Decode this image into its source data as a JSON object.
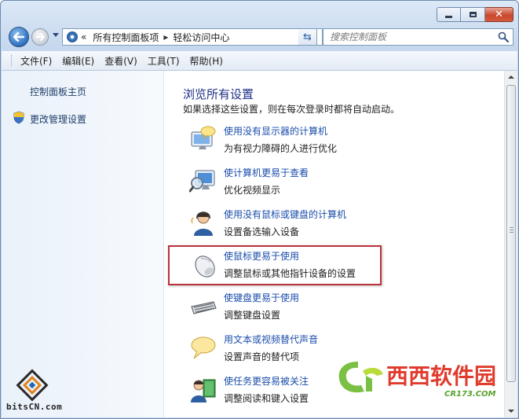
{
  "window": {
    "caption_buttons": [
      "minimize",
      "maximize",
      "close"
    ]
  },
  "nav": {
    "address_prefix": "«",
    "breadcrumbs": [
      "所有控制面板项",
      "轻松访问中心"
    ],
    "breadcrumb_separator": "▸",
    "search_placeholder": "搜索控制面板"
  },
  "menubar": {
    "items": [
      "文件(F)",
      "编辑(E)",
      "查看(V)",
      "工具(T)",
      "帮助(H)"
    ]
  },
  "sidebar": {
    "home_link": "控制面板主页",
    "admin_link": "更改管理设置"
  },
  "main": {
    "title": "浏览所有设置",
    "subtitle": "如果选择这些设置，则在每次登录时都将自动启动。",
    "items": [
      {
        "icon": "monitor-speech-icon",
        "link": "使用没有显示器的计算机",
        "desc": "为有视力障碍的人进行优化"
      },
      {
        "icon": "magnifier-monitor-icon",
        "link": "使计算机更易于查看",
        "desc": "优化视频显示"
      },
      {
        "icon": "person-headset-icon",
        "link": "使用没有鼠标或键盘的计算机",
        "desc": "设置备选输入设备"
      },
      {
        "icon": "mouse-icon",
        "link": "使鼠标更易于使用",
        "desc": "调整鼠标或其他指针设备的设置"
      },
      {
        "icon": "keyboard-icon",
        "link": "使键盘更易于使用",
        "desc": "调整键盘设置"
      },
      {
        "icon": "speech-bubble-icon",
        "link": "用文本或视频替代声音",
        "desc": "设置声音的替代项"
      },
      {
        "icon": "person-book-icon",
        "link": "使任务更容易被关注",
        "desc": "调整阅读和键入设置"
      }
    ]
  },
  "watermarks": {
    "bits": "bitsCN.com",
    "xixi_brand": "西西软件园",
    "xixi_domain": "CR173.COM"
  },
  "colors": {
    "link": "#1a4dab",
    "title": "#1e3287",
    "highlight_border": "#b9323a"
  }
}
